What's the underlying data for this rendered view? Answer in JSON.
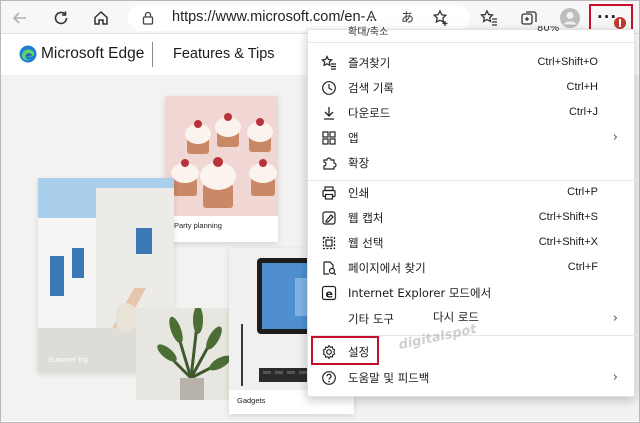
{
  "browser": {
    "url": "https://www.microsoft.com/en-...",
    "read_aloud_icon": "A",
    "translate_icon": "あ",
    "more_menu_badge": "1"
  },
  "page": {
    "brand": "Microsoft Edge",
    "section": "Features & Tips",
    "cards": {
      "party": "Party planning",
      "summer": "Summer trip",
      "gadgets": "Gadgets"
    },
    "watermark": "digitalspot"
  },
  "menu": {
    "zoom_label": "확대/축소",
    "zoom_value": "80%",
    "items": [
      {
        "icon": "favorites-icon",
        "label": "즐겨찾기",
        "shortcut": "Ctrl+Shift+O"
      },
      {
        "icon": "history-icon",
        "label": "검색 기록",
        "shortcut": "Ctrl+H"
      },
      {
        "icon": "download-icon",
        "label": "다운로드",
        "shortcut": "Ctrl+J"
      },
      {
        "icon": "apps-icon",
        "label": "앱",
        "shortcut": ""
      },
      {
        "icon": "extensions-icon",
        "label": "확장",
        "shortcut": ""
      },
      {
        "icon": "print-icon",
        "label": "인쇄",
        "shortcut": "Ctrl+P"
      },
      {
        "icon": "web-capture-icon",
        "label": "웹 캡처",
        "shortcut": "Ctrl+Shift+S"
      },
      {
        "icon": "web-select-icon",
        "label": "웹 선택",
        "shortcut": "Ctrl+Shift+X"
      },
      {
        "icon": "find-on-page-icon",
        "label": "페이지에서 찾기",
        "shortcut": "Ctrl+F"
      },
      {
        "icon": "ie-mode-icon",
        "label": "Internet Explorer 모드에서",
        "shortcut": ""
      },
      {
        "icon": "",
        "label": "기타 도구",
        "sublabel": "다시 로드",
        "shortcut": ""
      },
      {
        "icon": "settings-icon",
        "label": "설정",
        "shortcut": ""
      },
      {
        "icon": "help-icon",
        "label": "도움말 및 피드백",
        "shortcut": ""
      }
    ]
  },
  "colors": {
    "highlight": "#c8102e",
    "toolbar": "#f7f7f7",
    "menu_bg": "#ffffff"
  }
}
